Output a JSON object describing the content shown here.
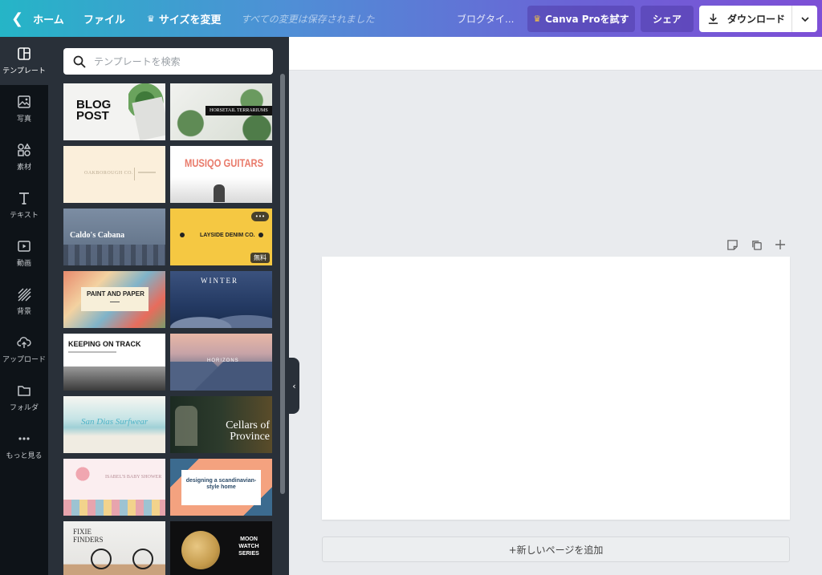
{
  "topbar": {
    "home_label": "ホーム",
    "file_label": "ファイル",
    "resize_label": "サイズを変更",
    "saved_status": "すべての変更は保存されました",
    "doc_title": "ブログタイ...",
    "pro_label": "Canva Proを試す",
    "share_label": "シェア",
    "download_label": "ダウンロード"
  },
  "rail": {
    "items": [
      {
        "label": "テンプレート",
        "icon": "layout-icon"
      },
      {
        "label": "写真",
        "icon": "photo-icon"
      },
      {
        "label": "素材",
        "icon": "elements-icon"
      },
      {
        "label": "テキスト",
        "icon": "text-icon"
      },
      {
        "label": "動画",
        "icon": "video-icon"
      },
      {
        "label": "背景",
        "icon": "background-icon"
      },
      {
        "label": "アップロード",
        "icon": "upload-icon"
      },
      {
        "label": "フォルダ",
        "icon": "folder-icon"
      },
      {
        "label": "もっと見る",
        "icon": "more-icon"
      }
    ]
  },
  "panel": {
    "search_placeholder": "テンプレートを検索",
    "templates": [
      {
        "title": "BLOG POST"
      },
      {
        "title": "HORSETAIL TERRARIUMS"
      },
      {
        "title": "OAKBOROUGH CO."
      },
      {
        "title": "MUSIQO GUITARS"
      },
      {
        "title": "Caldo's Cabana"
      },
      {
        "title": "LAYSIDE DENIM CO.",
        "badge": "無料",
        "more": "•••"
      },
      {
        "title": "PAINT AND PAPER"
      },
      {
        "title": "WINTER"
      },
      {
        "title": "KEEPING ON TRACK"
      },
      {
        "title": "HORIZONS"
      },
      {
        "title": "San Dias Surfwear"
      },
      {
        "title": "Cellars of Province"
      },
      {
        "title": "ISABEL'S BABY SHOWER"
      },
      {
        "title": "designing a scandinavian-style home"
      },
      {
        "title": "FIXIE FINDERS"
      },
      {
        "title": "MOON WATCH SERIES"
      }
    ]
  },
  "canvas": {
    "add_page_label": "+新しいページを追加"
  },
  "colors": {
    "topbar_gradient_start": "#25b5c7",
    "topbar_gradient_end": "#7d4fd6",
    "panel_bg": "#293039",
    "rail_bg": "#0e1318",
    "canvas_bg": "#e9ebee"
  }
}
